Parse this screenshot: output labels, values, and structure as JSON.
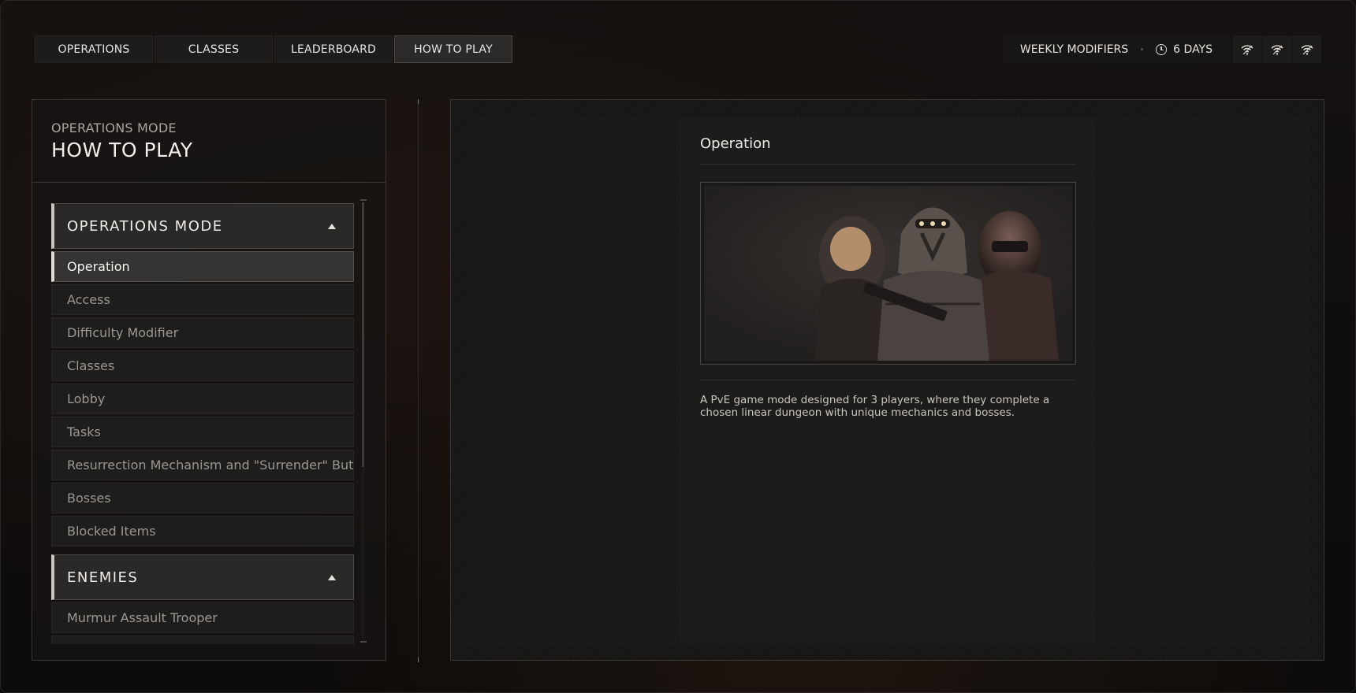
{
  "nav": {
    "tabs": [
      {
        "label": "OPERATIONS",
        "active": false
      },
      {
        "label": "CLASSES",
        "active": false
      },
      {
        "label": "LEADERBOARD",
        "active": false
      },
      {
        "label": "HOW TO PLAY",
        "active": true
      }
    ]
  },
  "status": {
    "weekly_label": "WEEKLY MODIFIERS",
    "timer": "6 DAYS",
    "timer_icon": "clock-icon",
    "signal_icons": [
      "wifi-icon",
      "wifi-icon",
      "wifi-icon"
    ]
  },
  "sidebar": {
    "subtitle": "OPERATIONS MODE",
    "title": "HOW TO PLAY",
    "sections": [
      {
        "label": "OPERATIONS MODE",
        "expanded": true,
        "items": [
          {
            "label": "Operation",
            "active": true
          },
          {
            "label": "Access",
            "active": false
          },
          {
            "label": "Difficulty Modifier",
            "active": false
          },
          {
            "label": "Classes",
            "active": false
          },
          {
            "label": "Lobby",
            "active": false
          },
          {
            "label": "Tasks",
            "active": false
          },
          {
            "label": "Resurrection Mechanism and \"Surrender\" Button",
            "active": false
          },
          {
            "label": "Bosses",
            "active": false
          },
          {
            "label": "Blocked Items",
            "active": false
          }
        ]
      },
      {
        "label": "ENEMIES",
        "expanded": true,
        "items": [
          {
            "label": "Murmur Assault Trooper",
            "active": false
          }
        ]
      }
    ]
  },
  "content": {
    "title": "Operation",
    "description": "A PvE game mode designed for 3 players, where they complete a chosen linear dungeon with unique mechanics and bosses."
  },
  "colors": {
    "background": "#0f0d0c",
    "panel": "#181716",
    "accent": "#dedbd7",
    "active_tab": "#2b2a29"
  }
}
